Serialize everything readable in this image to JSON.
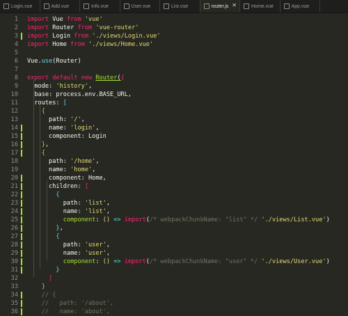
{
  "tabs": [
    {
      "label": "Login.vue"
    },
    {
      "label": "Add.vue"
    },
    {
      "label": "Info.vue"
    },
    {
      "label": "User.vue"
    },
    {
      "label": "List.vue"
    },
    {
      "label": "router.js",
      "active": true,
      "close": "✕"
    },
    {
      "label": "Home.vue"
    },
    {
      "label": "App.vue"
    }
  ],
  "lines": {
    "1": {
      "num": "1",
      "t": [
        "import",
        "Vue",
        "from",
        "'vue'"
      ]
    },
    "2": {
      "num": "2",
      "t": [
        "import",
        "Router",
        "from",
        "'vue-router'"
      ]
    },
    "3": {
      "num": "3",
      "t": [
        "import",
        "Login",
        "from",
        "'./views/Login.vue'"
      ]
    },
    "4": {
      "num": "4",
      "t": [
        "import",
        "Home",
        "from",
        "'./views/Home.vue'"
      ]
    },
    "5": {
      "num": "5",
      "t": []
    },
    "6": {
      "num": "6",
      "t": [
        "Vue",
        ".",
        "use",
        "(Router)"
      ]
    },
    "7": {
      "num": "7",
      "t": []
    },
    "8": {
      "num": "8",
      "t": [
        "export",
        "default",
        "new",
        "Router",
        "("
      ]
    },
    "9": {
      "num": "9",
      "t": [
        "mode",
        ":",
        "'history'",
        ","
      ]
    },
    "10": {
      "num": "10",
      "t": [
        "base",
        ": process.env.BASE_URL,"
      ]
    },
    "11": {
      "num": "11",
      "t": [
        "routes",
        ":",
        "["
      ]
    },
    "12": {
      "num": "12",
      "t": [
        "{"
      ]
    },
    "13": {
      "num": "13",
      "t": [
        "path",
        ":",
        "'/'",
        ","
      ]
    },
    "14": {
      "num": "14",
      "t": [
        "name",
        ":",
        "'login'",
        ","
      ]
    },
    "15": {
      "num": "15",
      "t": [
        "component",
        ": Login"
      ]
    },
    "16": {
      "num": "16",
      "t": [
        "}",
        ","
      ]
    },
    "17": {
      "num": "17",
      "t": [
        "{"
      ]
    },
    "18": {
      "num": "18",
      "t": [
        "path",
        ":",
        "'/home'",
        ","
      ]
    },
    "19": {
      "num": "19",
      "t": [
        "name",
        ":",
        "'home'",
        ","
      ]
    },
    "20": {
      "num": "20",
      "t": [
        "component",
        ": Home,"
      ]
    },
    "21": {
      "num": "21",
      "t": [
        "children",
        ":",
        "["
      ]
    },
    "22": {
      "num": "22",
      "t": [
        "{"
      ]
    },
    "23": {
      "num": "23",
      "t": [
        "path",
        ":",
        "'list'",
        ","
      ]
    },
    "24": {
      "num": "24",
      "t": [
        "name",
        ":",
        "'list'",
        ","
      ]
    },
    "25": {
      "num": "25",
      "t": [
        "component",
        ":",
        "()",
        "=>",
        "import",
        "(",
        "/* webpackChunkName: \"list\" */",
        "'./views/List.vue'",
        ")"
      ]
    },
    "26": {
      "num": "26",
      "t": [
        "}",
        ","
      ]
    },
    "27": {
      "num": "27",
      "t": [
        "{"
      ]
    },
    "28": {
      "num": "28",
      "t": [
        "path",
        ":",
        "'user'",
        ","
      ]
    },
    "29": {
      "num": "29",
      "t": [
        "name",
        ":",
        "'user'",
        ","
      ]
    },
    "30": {
      "num": "30",
      "t": [
        "component",
        ":",
        "()",
        "=>",
        "import",
        "(",
        "/* webpackChunkName: \"user\" */",
        "'./views/User.vue'",
        ")"
      ]
    },
    "31": {
      "num": "31",
      "t": [
        "}"
      ]
    },
    "32": {
      "num": "32",
      "t": [
        "]"
      ]
    },
    "33": {
      "num": "33",
      "t": [
        "}"
      ]
    },
    "34": {
      "num": "34",
      "t": [
        "// {"
      ]
    },
    "35": {
      "num": "35",
      "t": [
        "//   path: '/about',"
      ]
    },
    "36": {
      "num": "36",
      "t": [
        "//   name: 'about',"
      ]
    }
  },
  "colors": {
    "background": "#272822",
    "tabbar": "#1e1f1c",
    "keyword": "#f92672",
    "string": "#e6db74",
    "function": "#66d9ef",
    "property": "#a6e22e",
    "comment": "#75715e",
    "modified_marker": "#a6e22e"
  },
  "icons": {
    "tab_file": "file-icon",
    "tab_close": "close-icon"
  }
}
